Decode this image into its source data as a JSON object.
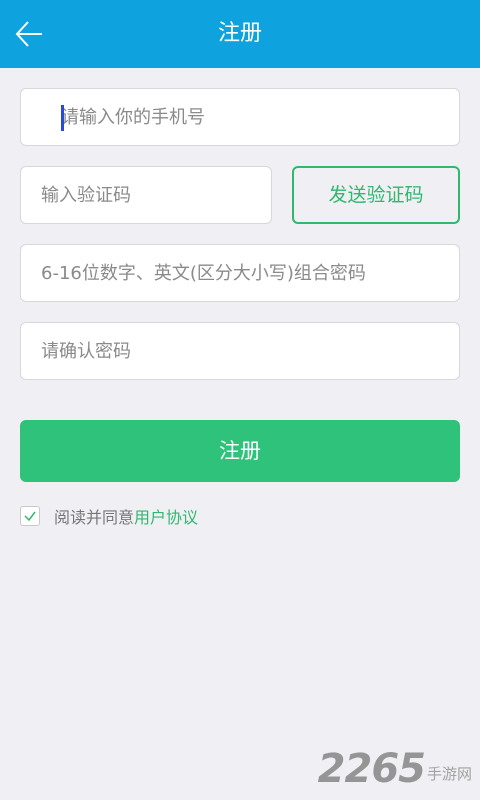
{
  "header": {
    "title": "注册",
    "back_icon": "arrow-left-icon",
    "background_color": "#0ea2df"
  },
  "form": {
    "phone": {
      "placeholder": "请输入你的手机号",
      "value": ""
    },
    "code": {
      "placeholder": "输入验证码",
      "value": ""
    },
    "send_code_label": "发送验证码",
    "password": {
      "placeholder": "6-16位数字、英文(区分大小写)组合密码",
      "value": ""
    },
    "confirm_password": {
      "placeholder": "请确认密码",
      "value": ""
    },
    "submit_label": "注册",
    "accent_color": "#2ec27a"
  },
  "agreement": {
    "checked": true,
    "text": "阅读并同意",
    "link_text": "用户协议"
  },
  "watermark": {
    "number": "2265",
    "suffix": "手游网"
  }
}
